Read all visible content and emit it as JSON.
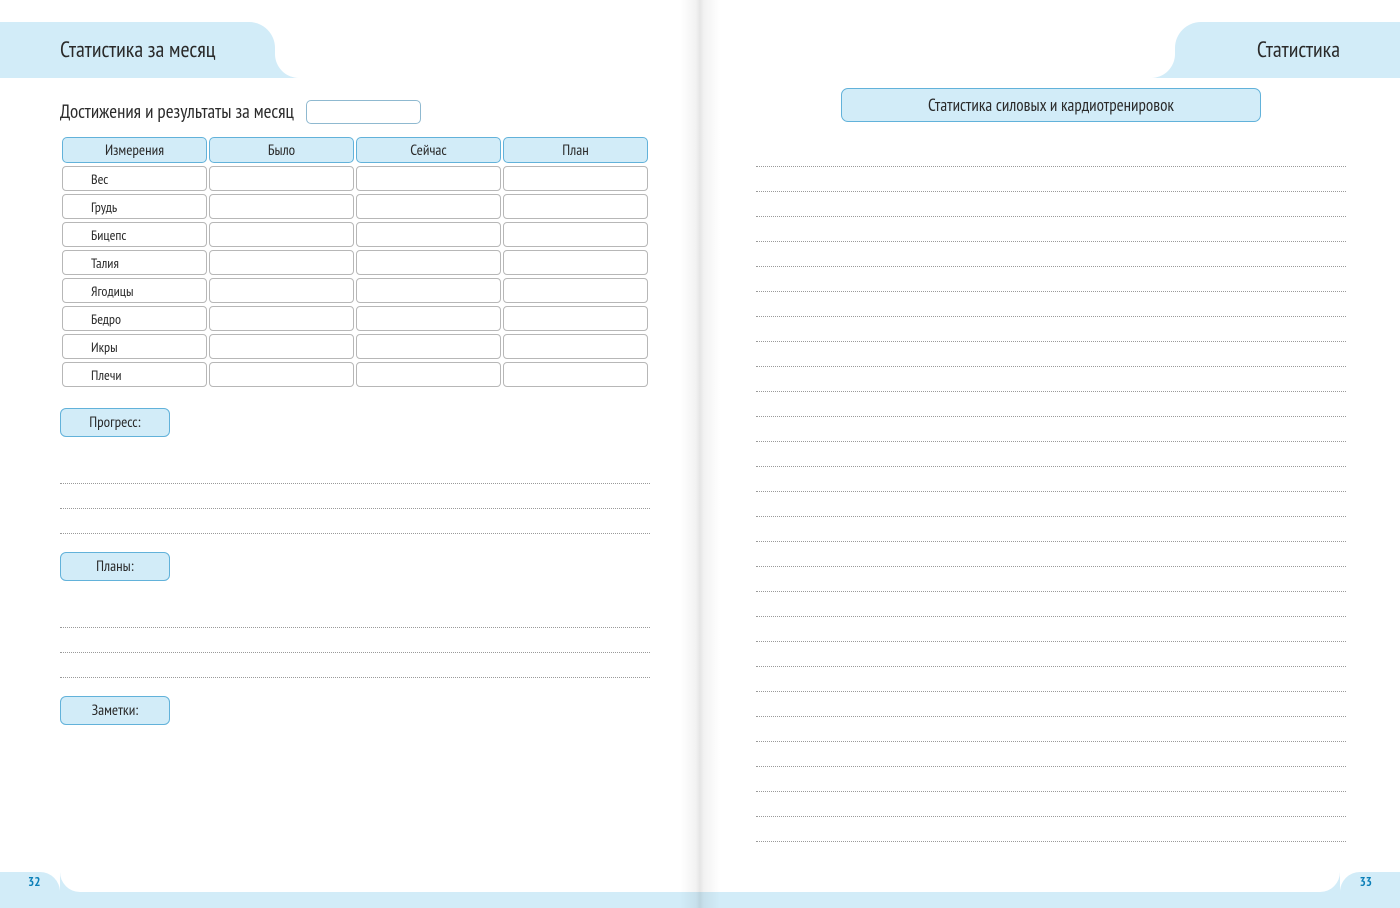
{
  "left": {
    "tab_title": "Статистика за месяц",
    "subtitle": "Достижения и результаты за месяц",
    "table": {
      "headers": [
        "Измерения",
        "Было",
        "Сейчас",
        "План"
      ],
      "rows": [
        "Вес",
        "Грудь",
        "Бицепс",
        "Талия",
        "Ягодицы",
        "Бедро",
        "Икры",
        "Плечи"
      ]
    },
    "sections": {
      "progress": "Прогресс:",
      "plans": "Планы:",
      "notes": "Заметки:"
    },
    "page_number": "32"
  },
  "right": {
    "tab_title": "Статистика",
    "pill_title": "Статистика силовых и кардиотренировок",
    "page_number": "33"
  }
}
